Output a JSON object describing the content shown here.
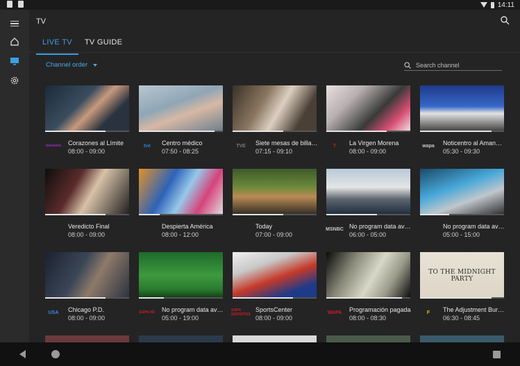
{
  "status_bar": {
    "time": "14:11"
  },
  "header": {
    "title": "TV"
  },
  "tabs": [
    {
      "label": "LIVE TV"
    },
    {
      "label": "TV GUIDE"
    }
  ],
  "filter": {
    "order_label": "Channel order"
  },
  "search": {
    "placeholder": "Search channel"
  },
  "channels": [
    {
      "name": "Corazones al Límite",
      "time": "08:00 - 09:00",
      "logo": "Univision",
      "progress": 0.72
    },
    {
      "name": "Centro médico",
      "time": "07:50 - 08:25",
      "logo": "tve",
      "progress": 0.9
    },
    {
      "name": "Siete mesas de billar f...",
      "time": "07:15 - 09:10",
      "logo": "TVE",
      "progress": 0.6
    },
    {
      "name": "La Virgen Morena",
      "time": "08:00 - 09:00",
      "logo": "T",
      "progress": 0.72
    },
    {
      "name": "Noticentro al Amanecer",
      "time": "05:30 - 09:30",
      "logo": "wapa",
      "progress": 0.85
    },
    {
      "name": "Veredicto Final",
      "time": "08:00 - 09:00",
      "logo": "",
      "progress": 0.72
    },
    {
      "name": "Despierta América",
      "time": "08:00 - 12:00",
      "logo": "",
      "progress": 0.25
    },
    {
      "name": "Today",
      "time": "07:00 - 09:00",
      "logo": "",
      "progress": 0.6
    },
    {
      "name": "No program data avail...",
      "time": "06:00 - 05:00",
      "logo": "MSNBC",
      "progress": 0.6
    },
    {
      "name": "No program data avail...",
      "time": "05:00 - 15:00",
      "logo": "",
      "progress": 0.35
    },
    {
      "name": "Chicago P.D.",
      "time": "08:00 - 09:00",
      "logo": "USA",
      "progress": 0.72
    },
    {
      "name": "No program data avail...",
      "time": "05:00 - 19:00",
      "logo": "ESPN HD",
      "progress": 0.3
    },
    {
      "name": "SportsCenter",
      "time": "08:00 - 09:00",
      "logo": "ESPN DEPORTES",
      "progress": 0.72
    },
    {
      "name": "Programación pagada",
      "time": "08:00 - 08:30",
      "logo": "WAPA",
      "progress": 0.9
    },
    {
      "name": "The Adjustment Bureau",
      "time": "06:30 - 08:45",
      "logo": "F",
      "progress": 0.85
    }
  ],
  "thumbnail_captions": [
    "TO THE MIDNIGHT PARTY"
  ],
  "colors": {
    "accent": "#3c9fe0",
    "background": "#242424",
    "rail": "#2b2b2b"
  }
}
